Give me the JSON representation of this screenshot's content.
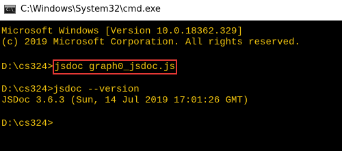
{
  "window": {
    "title": "C:\\Windows\\System32\\cmd.exe",
    "icon": "cmd-icon",
    "icon_glyph": "C:\\_"
  },
  "console": {
    "text_color": "#f1c40f",
    "highlight_color": "#e53935",
    "lines": [
      "Microsoft Windows [Version 10.0.18362.329]",
      "(c) 2019 Microsoft Corporation. All rights reserved.",
      {
        "prompt": "D:\\cs324>",
        "command": "jsdoc graph0_jsdoc.js"
      },
      "D:\\cs324>jsdoc --version",
      "JSDoc 3.6.3 (Sun, 14 Jul 2019 17:01:26 GMT)",
      "D:\\cs324>"
    ]
  }
}
